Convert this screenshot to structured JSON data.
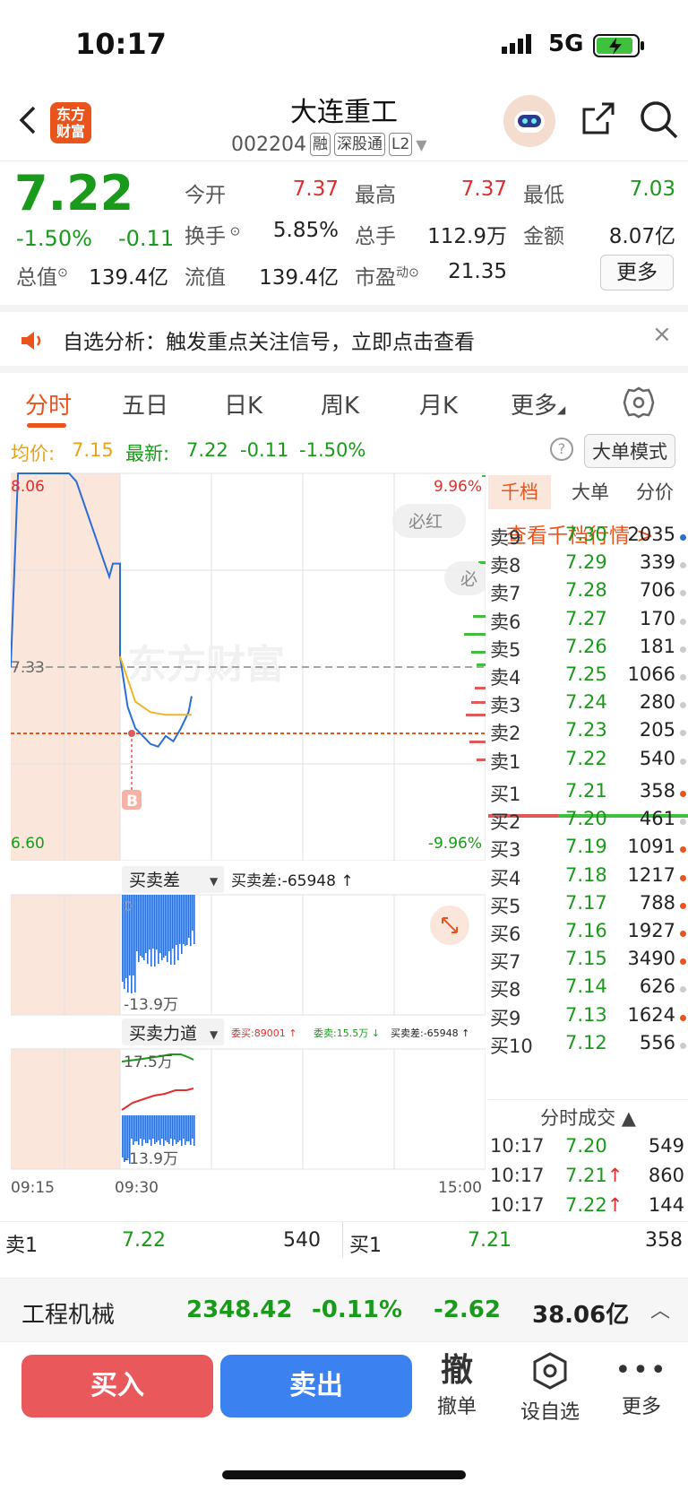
{
  "status": {
    "time": "10:17",
    "network": "5G"
  },
  "header": {
    "title": "大连重工",
    "code": "002204",
    "tags": [
      "融",
      "深股通",
      "L2"
    ],
    "logo_line1": "东方",
    "logo_line2": "财富"
  },
  "quote": {
    "price": "7.22",
    "pct": "-1.50%",
    "change": "-0.11",
    "fields": [
      {
        "label": "今开",
        "value": "7.37",
        "color": "#e02f2f"
      },
      {
        "label": "最高",
        "value": "7.37",
        "color": "#e02f2f"
      },
      {
        "label": "最低",
        "value": "7.03",
        "color": "#1a9a1a"
      },
      {
        "label": "换手",
        "value": "5.85%",
        "color": "#222"
      },
      {
        "label": "总手",
        "value": "112.9万",
        "color": "#222"
      },
      {
        "label": "金额",
        "value": "8.07亿",
        "color": "#222"
      },
      {
        "label": "总值",
        "value": "139.4亿",
        "color": "#222"
      },
      {
        "label": "流值",
        "value": "139.4亿",
        "color": "#222"
      },
      {
        "label": "市盈",
        "value": "21.35",
        "color": "#222"
      }
    ],
    "pe_sup": "动",
    "more": "更多"
  },
  "notice": {
    "text": "自选分析：触发重点关注信号，立即点击查看"
  },
  "tabs": [
    "分时",
    "五日",
    "日K",
    "周K",
    "月K",
    "更多"
  ],
  "info": {
    "avg_label": "均价:",
    "avg": "7.15",
    "latest_label": "最新:",
    "latest": "7.22",
    "chg": "-0.11",
    "pct": "-1.50%",
    "mode_btn": "大单模式"
  },
  "chart": {
    "price_top": "8.06",
    "price_bottom": "6.60",
    "pct_top": "9.96%",
    "pct_bottom": "-9.96%",
    "prev_close": "7.33",
    "watermark": "东方财富",
    "bubble1": "必红",
    "bubble2": "必",
    "b_marker": "B",
    "panel2_select": "买卖差",
    "panel2_value": "买卖差:-65948 ↑",
    "panel2_label": "-13.9万",
    "panel2_zero": "0",
    "panel3_select": "买卖力道",
    "panel3_buy": "委买:89001 ↑",
    "panel3_sell": "委卖:15.5万 ↓",
    "panel3_diff": "买卖差:-65948 ↑",
    "panel3_top": "17.5万",
    "panel3_bottom": "-13.9万",
    "time_start": "09:15",
    "time_mid": "09:30",
    "time_end": "15:00"
  },
  "chart_data": {
    "type": "line",
    "title": "",
    "xlabel": "",
    "ylabel": "",
    "ylim": [
      6.6,
      8.06
    ],
    "series": [
      {
        "x": [
          "09:15",
          "09:16",
          "09:17",
          "09:18",
          "09:19",
          "09:20",
          "09:21",
          "09:22",
          "09:23",
          "09:24",
          "09:25",
          "09:30",
          "09:35",
          "09:40",
          "09:45",
          "09:50",
          "09:55",
          "10:00",
          "10:05",
          "10:10",
          "10:15",
          "10:17"
        ],
        "values": [
          7.33,
          8.06,
          8.06,
          8.06,
          8.06,
          8.06,
          8.06,
          8.06,
          8.06,
          8.03,
          7.67,
          7.37,
          7.18,
          7.1,
          7.07,
          7.04,
          7.03,
          7.07,
          7.05,
          7.1,
          7.16,
          7.22
        ]
      },
      {
        "x": [
          "09:30",
          "09:40",
          "09:50",
          "10:00",
          "10:10",
          "10:17"
        ],
        "values": [
          7.37,
          7.2,
          7.16,
          7.15,
          7.15,
          7.15
        ]
      }
    ]
  },
  "book": {
    "tabs": [
      "千档",
      "大单",
      "分价"
    ],
    "link": "查看千档行情 >",
    "asks": [
      {
        "label": "卖9",
        "price": "7.30",
        "vol": "2035",
        "dot": "#2a6dd6"
      },
      {
        "label": "卖8",
        "price": "7.29",
        "vol": "339",
        "dot": "#ccc"
      },
      {
        "label": "卖7",
        "price": "7.28",
        "vol": "706",
        "dot": "#ccc"
      },
      {
        "label": "卖6",
        "price": "7.27",
        "vol": "170",
        "dot": "#ccc"
      },
      {
        "label": "卖5",
        "price": "7.26",
        "vol": "181",
        "dot": "#ccc"
      },
      {
        "label": "卖4",
        "price": "7.25",
        "vol": "1066",
        "dot": "#ccc"
      },
      {
        "label": "卖3",
        "price": "7.24",
        "vol": "280",
        "dot": "#ccc"
      },
      {
        "label": "卖2",
        "price": "7.23",
        "vol": "205",
        "dot": "#ccc"
      },
      {
        "label": "卖1",
        "price": "7.22",
        "vol": "540",
        "dot": "#ccc"
      }
    ],
    "bids": [
      {
        "label": "买1",
        "price": "7.21",
        "vol": "358",
        "dot": "#e9541c"
      },
      {
        "label": "买2",
        "price": "7.20",
        "vol": "461",
        "dot": "#ccc"
      },
      {
        "label": "买3",
        "price": "7.19",
        "vol": "1091",
        "dot": "#e9541c"
      },
      {
        "label": "买4",
        "price": "7.18",
        "vol": "1217",
        "dot": "#e9541c"
      },
      {
        "label": "买5",
        "price": "7.17",
        "vol": "788",
        "dot": "#e9541c"
      },
      {
        "label": "买6",
        "price": "7.16",
        "vol": "1927",
        "dot": "#e9541c"
      },
      {
        "label": "买7",
        "price": "7.15",
        "vol": "3490",
        "dot": "#e9541c"
      },
      {
        "label": "买8",
        "price": "7.14",
        "vol": "626",
        "dot": "#ccc"
      },
      {
        "label": "买9",
        "price": "7.13",
        "vol": "1624",
        "dot": "#e9541c"
      },
      {
        "label": "买10",
        "price": "7.12",
        "vol": "556",
        "dot": "#ccc"
      }
    ],
    "trades_header": "分时成交 ▲",
    "trades": [
      {
        "time": "10:17",
        "price": "7.20",
        "arrow": "",
        "vol": "549"
      },
      {
        "time": "10:17",
        "price": "7.21",
        "arrow": "↑",
        "vol": "860"
      },
      {
        "time": "10:17",
        "price": "7.22",
        "arrow": "↑",
        "vol": "144"
      }
    ]
  },
  "bottom_quote": {
    "sell_label": "卖1",
    "sell_price": "7.22",
    "sell_vol": "540",
    "buy_label": "买1",
    "buy_price": "7.21",
    "buy_vol": "358"
  },
  "sector": {
    "name": "工程机械",
    "index": "2348.42",
    "pct": "-0.11%",
    "chg": "-2.62",
    "amount": "38.06亿"
  },
  "actions": {
    "buy": "买入",
    "sell": "卖出",
    "cancel_glyph": "撤",
    "cancel": "撤单",
    "watch": "设自选",
    "more": "更多"
  }
}
